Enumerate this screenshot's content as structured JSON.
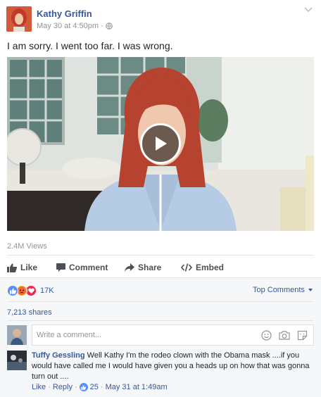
{
  "post": {
    "author": "Kathy Griffin",
    "timestamp": "May 30 at 4:50pm",
    "separator": "·",
    "audience_icon": "globe-icon",
    "text": "I am sorry. I went too far. I was wrong."
  },
  "video": {
    "views": "2.4M Views"
  },
  "actions": {
    "like": "Like",
    "comment": "Comment",
    "share": "Share",
    "embed": "Embed"
  },
  "reactions": {
    "icons": [
      "like-reaction-icon",
      "angry-reaction-icon",
      "love-reaction-icon"
    ],
    "count": "17K",
    "top_comments": "Top Comments"
  },
  "shares": "7,213 shares",
  "comment_input": {
    "placeholder": "Write a comment..."
  },
  "comment": {
    "author": "Tuffy Gessling",
    "text": "Well Kathy I'm the rodeo clown with the Obama mask ....if you would have called me I would have given you a heads up on how that was gonna turn out ....",
    "like": "Like",
    "reply": "Reply",
    "likes": "25",
    "time": "May 31 at 1:49am"
  },
  "colors": {
    "link": "#365899",
    "meta": "#90949c",
    "text": "#1d2129",
    "like_blue": "#5890ff",
    "angry_orange": "#f7b125",
    "love_red": "#f0284a"
  }
}
